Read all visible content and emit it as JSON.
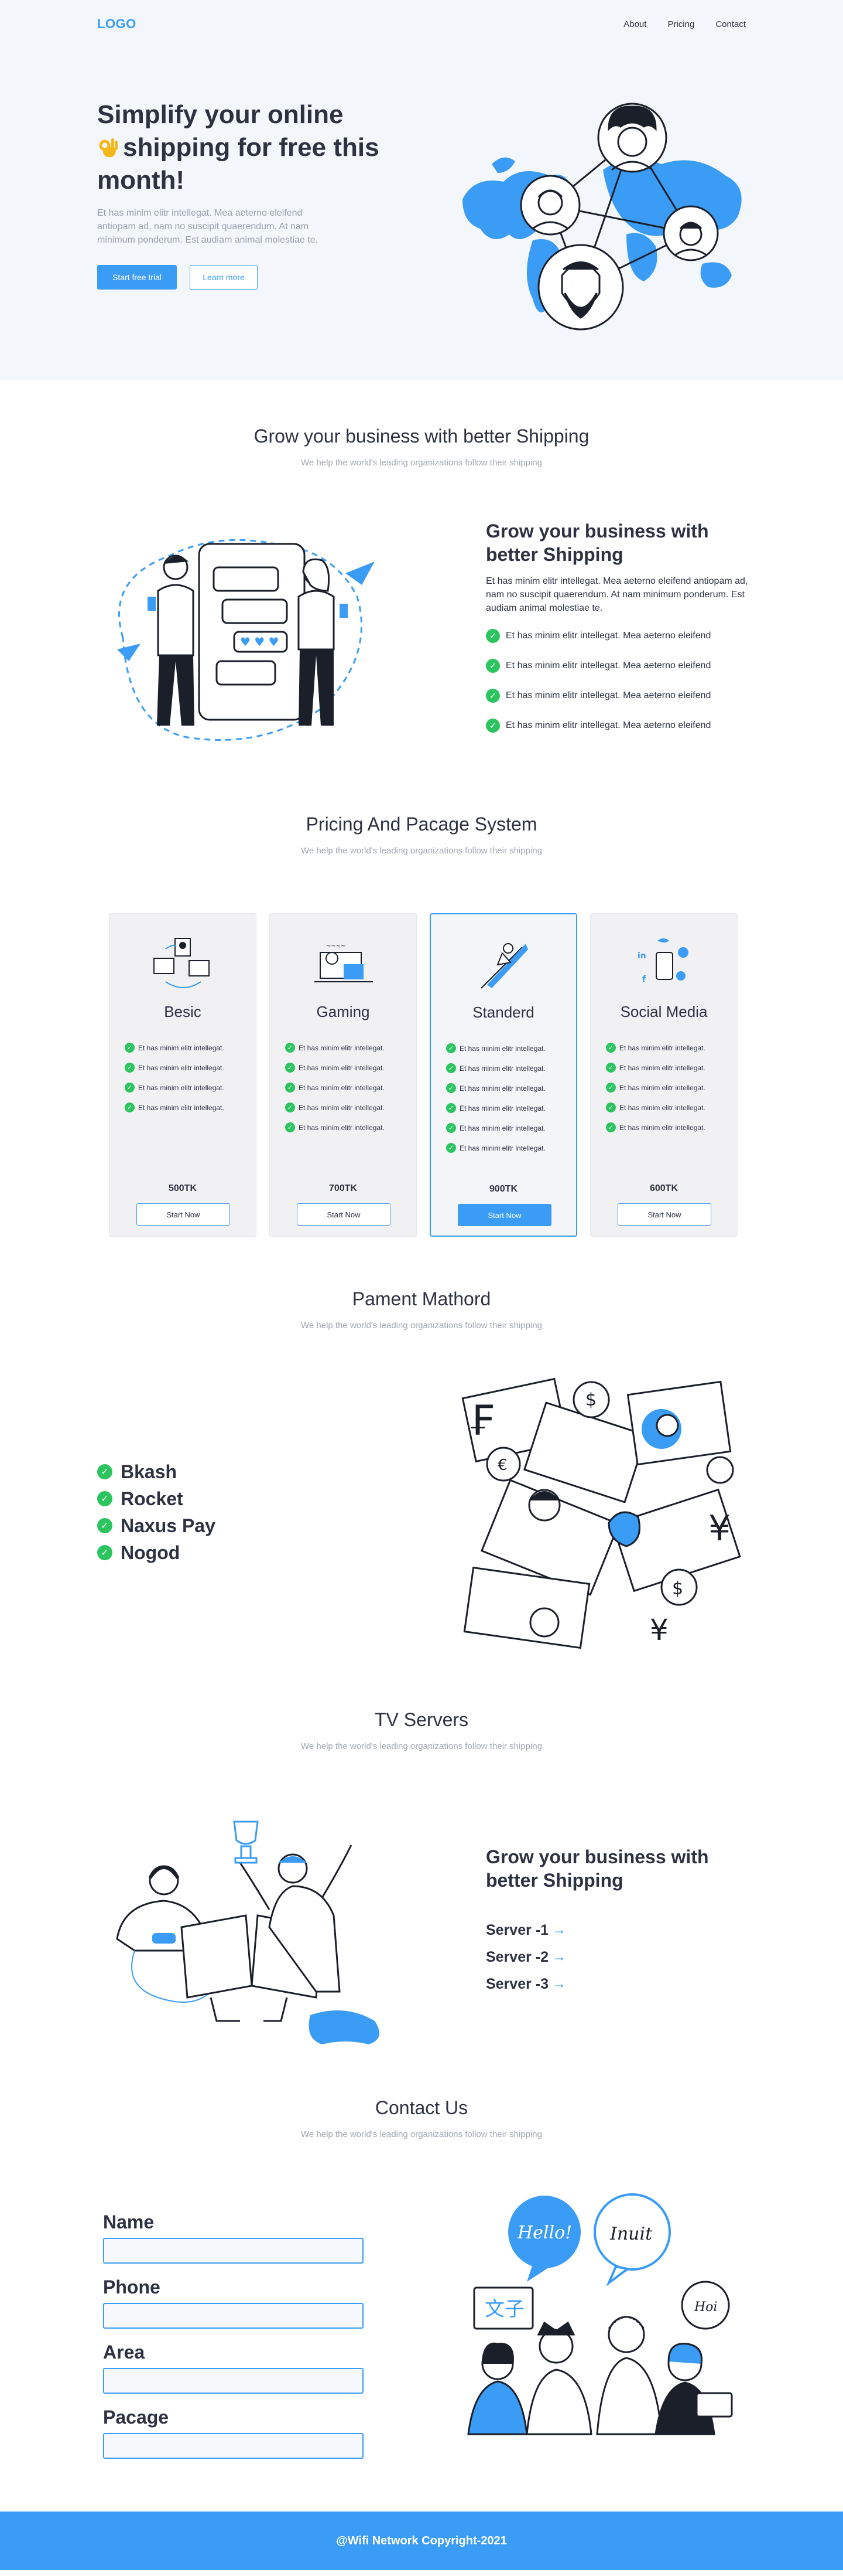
{
  "nav": {
    "logo": "LOGO",
    "links": [
      "About",
      "Pricing",
      "Contact"
    ]
  },
  "hero": {
    "title_line1": "Simplify your online",
    "title_line2": "shipping for free this",
    "title_line3": "month!",
    "emoji": "ok-hand-emoji",
    "subtitle": "Et has minim elitr intellegat. Mea aeterno eleifend antiopam ad, nam no suscipit quaerendum. At nam minimum ponderum. Est audiam animal molestiae te.",
    "primary_button": "Start free trial",
    "secondary_button": "Learn more"
  },
  "grow": {
    "title": "Grow your business with better Shipping",
    "subtitle": "We help the world's leading organizations follow their shipping",
    "block_title": "Grow your business with better Shipping",
    "block_text": "Et has minim elitr intellegat. Mea aeterno eleifend antiopam ad, nam no suscipit quaerendum. At nam minimum ponderum. Est audiam animal molestiae te.",
    "checks": [
      "Et has minim elitr intellegat. Mea aeterno eleifend",
      "Et has minim elitr intellegat. Mea aeterno eleifend",
      "Et has minim elitr intellegat. Mea aeterno eleifend",
      "Et has minim elitr intellegat. Mea aeterno eleifend"
    ]
  },
  "pricing": {
    "title": "Pricing And Pacage System",
    "subtitle": "We help the world's leading organizations follow their shipping",
    "cards": [
      {
        "name": "Besic",
        "price": "500TK",
        "button": "Start Now",
        "features": [
          "Et has minim elitr intellegat.",
          "Et has minim elitr intellegat.",
          "Et has minim elitr intellegat.",
          "Et has minim elitr intellegat."
        ]
      },
      {
        "name": "Gaming",
        "price": "700TK",
        "button": "Start Now",
        "features": [
          "Et has minim elitr intellegat.",
          "Et has minim elitr intellegat.",
          "Et has minim elitr intellegat.",
          "Et has minim elitr intellegat.",
          "Et has minim elitr intellegat."
        ]
      },
      {
        "name": "Standerd",
        "price": "900TK",
        "button": "Start Now",
        "features": [
          "Et has minim elitr intellegat.",
          "Et has minim elitr intellegat.",
          "Et has minim elitr intellegat.",
          "Et has minim elitr intellegat.",
          "Et has minim elitr intellegat.",
          "Et has minim elitr intellegat."
        ]
      },
      {
        "name": "Social Media",
        "price": "600TK",
        "button": "Start Now",
        "features": [
          "Et has minim elitr intellegat.",
          "Et has minim elitr intellegat.",
          "Et has minim elitr intellegat.",
          "Et has minim elitr intellegat.",
          "Et has minim elitr intellegat."
        ]
      }
    ]
  },
  "payment": {
    "title": "Pament Mathord",
    "subtitle": "We help the world's leading organizations follow their shipping",
    "methods": [
      "Bkash",
      "Rocket",
      "Naxus Pay",
      "Nogod"
    ]
  },
  "tv": {
    "title": "TV Servers",
    "subtitle": "We help the world's leading organizations follow their shipping",
    "block_title": "Grow your business with better Shipping",
    "servers": [
      "Server -1",
      "Server -2",
      "Server -3"
    ],
    "arrow": "→"
  },
  "contact": {
    "title": "Contact Us",
    "subtitle": "We help the world's leading organizations follow their shipping",
    "fields": [
      "Name",
      "Phone",
      "Area",
      "Pacage"
    ],
    "bubbles": [
      "Hello!",
      "Inuit",
      "文子",
      "Hoi"
    ]
  },
  "footer": {
    "text": "@Wifi Network Copyright-2021"
  },
  "colors": {
    "accent": "#3a9cf4",
    "check": "#2bc45f",
    "hero_bg": "#f3f6fa",
    "footer_bg": "#3a9cf4"
  }
}
